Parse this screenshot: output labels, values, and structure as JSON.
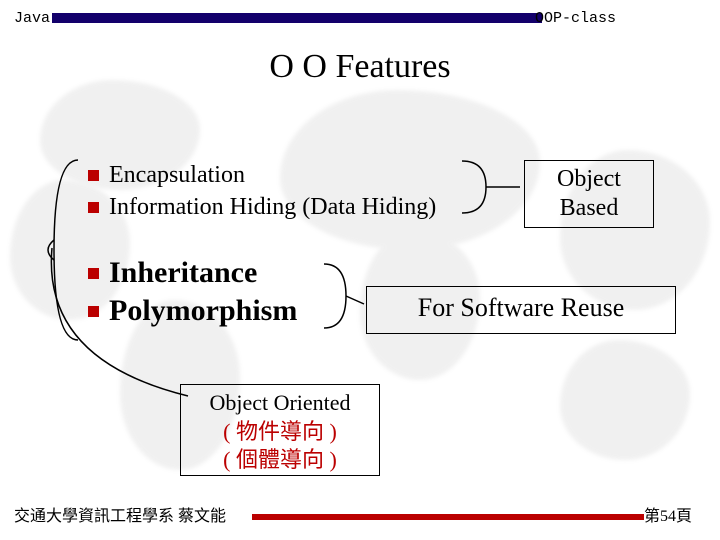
{
  "header": {
    "left": "Java",
    "right": "OOP-class"
  },
  "title": "O O Features",
  "bullets": {
    "encapsulation": "Encapsulation",
    "info_hiding": "Information Hiding (Data Hiding)",
    "inheritance": "Inheritance",
    "polymorphism": "Polymorphism"
  },
  "boxes": {
    "object_based_l1": "Object",
    "object_based_l2": "Based",
    "software_reuse": "For Software Reuse",
    "object_oriented_title": "Object Oriented",
    "object_oriented_cn1": "( 物件導向 )",
    "object_oriented_cn2": "( 個體導向 )"
  },
  "footer": {
    "left": "交通大學資訊工程學系  蔡文能",
    "right": "第54頁"
  },
  "colors": {
    "navy": "#13006b",
    "red": "#b00000"
  }
}
